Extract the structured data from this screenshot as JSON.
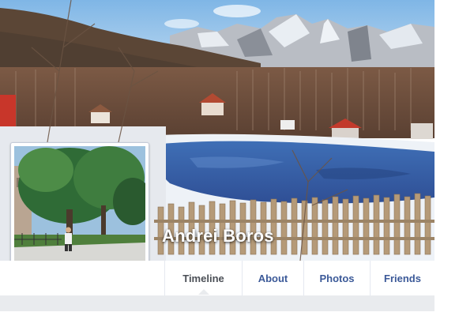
{
  "profile": {
    "name": "Andrei Boros"
  },
  "nav": {
    "tabs": [
      {
        "label": "Timeline",
        "active": true
      },
      {
        "label": "About",
        "active": false
      },
      {
        "label": "Photos",
        "active": false
      },
      {
        "label": "Friends",
        "active": false
      }
    ]
  },
  "colors": {
    "link": "#3b5998",
    "active_tab": "#4b4f56",
    "page_bg": "#e9ebee"
  },
  "images": {
    "cover": "mountain-lake-winter-landscape",
    "profile_picture": "person-under-trees-in-park"
  }
}
